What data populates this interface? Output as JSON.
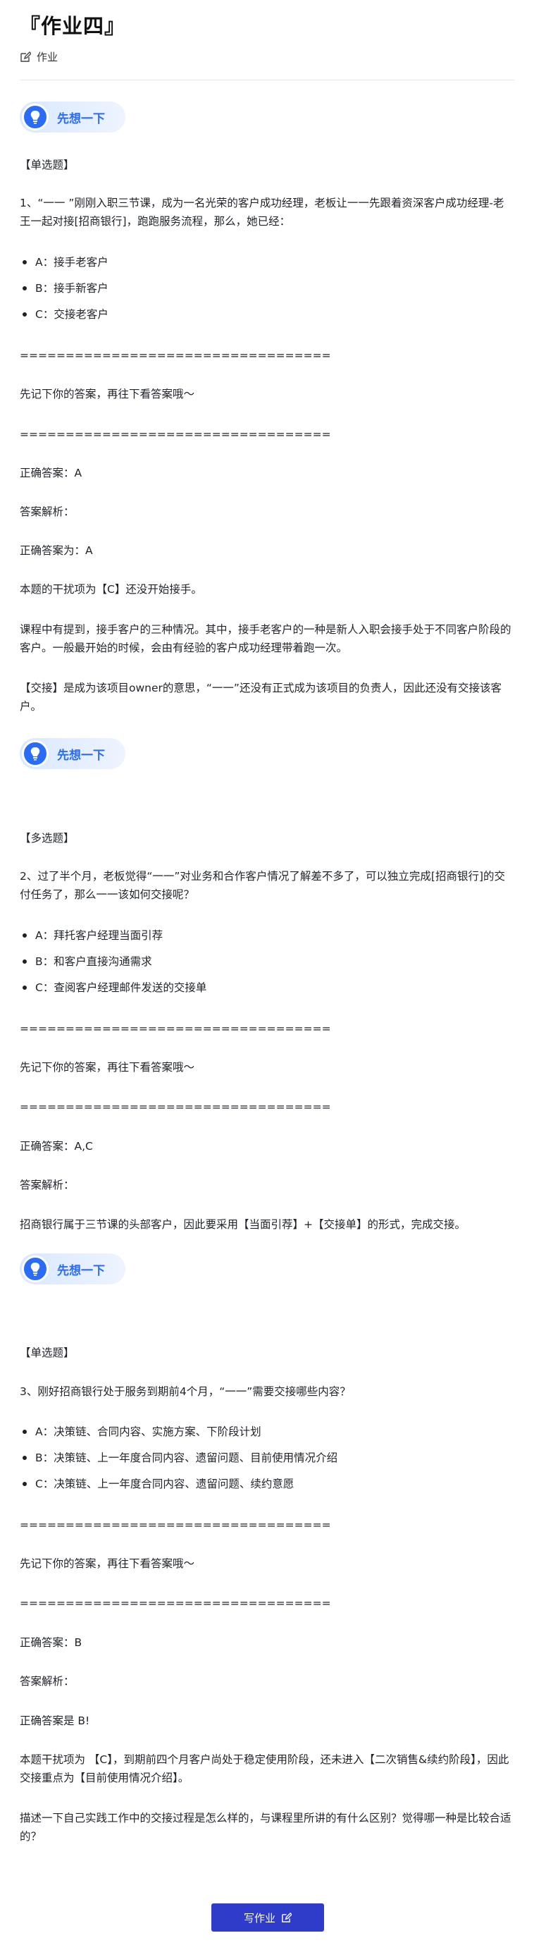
{
  "header": {
    "title": "『作业四』",
    "crumb": "作业"
  },
  "think_label": "先想一下",
  "q1": {
    "type": "【单选题】",
    "question": "1、“一一 ”刚刚入职三节课，成为一名光荣的客户成功经理，老板让一一先跟着资深客户成功经理-老王一起对接[招商银行]，跑跑服务流程，那么，她已经：",
    "options": [
      "A：接手老客户",
      "B：接手新客户",
      "C：交接老客户"
    ],
    "divider": "==================================",
    "remind": "先记下你的答案，再往下看答案哦～",
    "answer": "正确答案：A",
    "analysis_label": "答案解析：",
    "correct": "正确答案为：A",
    "p1": "本题的干扰项为【C】还没开始接手。",
    "p2": "课程中有提到，接手客户的三种情况。其中，接手老客户的一种是新人入职会接手处于不同客户阶段的客户。一般最开始的时候，会由有经验的客户成功经理带着跑一次。",
    "p3": "【交接】是成为该项目owner的意思，“一一”还没有正式成为该项目的负责人，因此还没有交接该客户。"
  },
  "q2": {
    "type": "【多选题】",
    "question": "2、过了半个月，老板觉得“一一”对业务和合作客户情况了解差不多了，可以独立完成[招商银行]的交付任务了，那么一一该如何交接呢？",
    "options": [
      "A：拜托客户经理当面引荐",
      "B：和客户直接沟通需求",
      "C：查阅客户经理邮件发送的交接单"
    ],
    "divider": "==================================",
    "remind": "先记下你的答案，再往下看答案哦～",
    "answer": "正确答案：A,C",
    "analysis_label": "答案解析：",
    "p1": "招商银行属于三节课的头部客户，因此要采用【当面引荐】+【交接单】的形式，完成交接。"
  },
  "q3": {
    "type": "【单选题】",
    "question": "3、刚好招商银行处于服务到期前4个月，“一一”需要交接哪些内容？",
    "options": [
      "A：决策链、合同内容、实施方案、下阶段计划",
      "B：决策链、上一年度合同内容、遗留问题、目前使用情况介绍",
      "C：决策链、上一年度合同内容、遗留问题、续约意愿"
    ],
    "divider": "==================================",
    "remind": "先记下你的答案，再往下看答案哦～",
    "answer": "正确答案：B",
    "analysis_label": "答案解析：",
    "correct": "正确答案是 B!",
    "p1": "本题干扰项为 【C】，到期前四个月客户尚处于稳定使用阶段，还未进入【二次销售&续约阶段】，因此交接重点为【目前使用情况介绍】。",
    "p2": "描述一下自己实践工作中的交接过程是怎么样的，与课程里所讲的有什么区别？觉得哪一种是比较合适的？"
  },
  "submit_label": "写作业",
  "colors": {
    "accent": "#2b6cf6",
    "button": "#2f3bc9",
    "pill_bg": "#dfeaff"
  }
}
